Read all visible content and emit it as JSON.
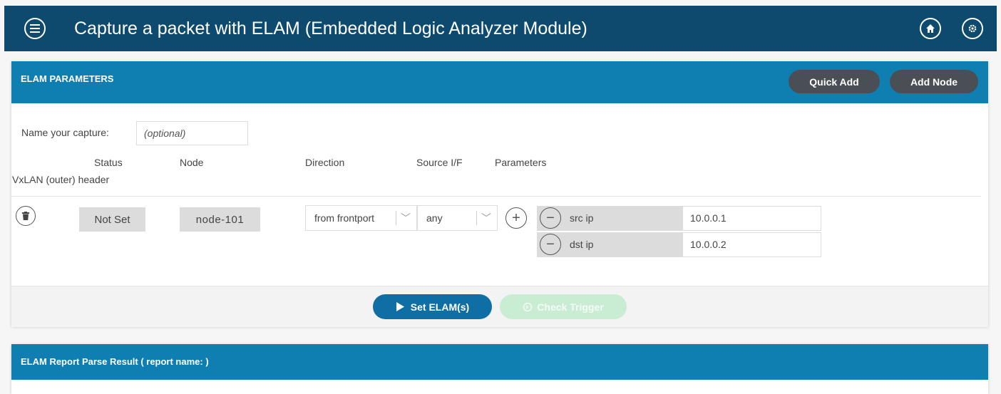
{
  "app": {
    "title": "Capture a packet with ELAM (Embedded Logic Analyzer Module)"
  },
  "elam_panel": {
    "title": "ELAM PARAMETERS",
    "quick_add_label": "Quick Add",
    "add_node_label": "Add Node",
    "capture_name_label": "Name your capture:",
    "capture_name_placeholder": "(optional)",
    "columns": {
      "status": "Status",
      "node": "Node",
      "direction": "Direction",
      "source_if": "Source I/F",
      "parameters": "Parameters",
      "vxlan": "VxLAN (outer) header"
    },
    "row": {
      "status": "Not Set",
      "node": "node-101",
      "direction": "from frontport",
      "source_if": "any",
      "params": [
        {
          "name": "src ip",
          "value": "10.0.0.1"
        },
        {
          "name": "dst ip",
          "value": "10.0.0.2"
        }
      ]
    },
    "set_elam_label": "Set ELAM(s)",
    "check_trigger_label": "Check Trigger"
  },
  "report_panel": {
    "title": "ELAM Report Parse Result ( report name: )"
  },
  "colors": {
    "topbar": "#0d4a6e",
    "panel_header": "#0f7eb0",
    "primary_button": "#0f6fa4",
    "dark_button": "#4a4f55",
    "disabled_button": "#c9edd3"
  }
}
